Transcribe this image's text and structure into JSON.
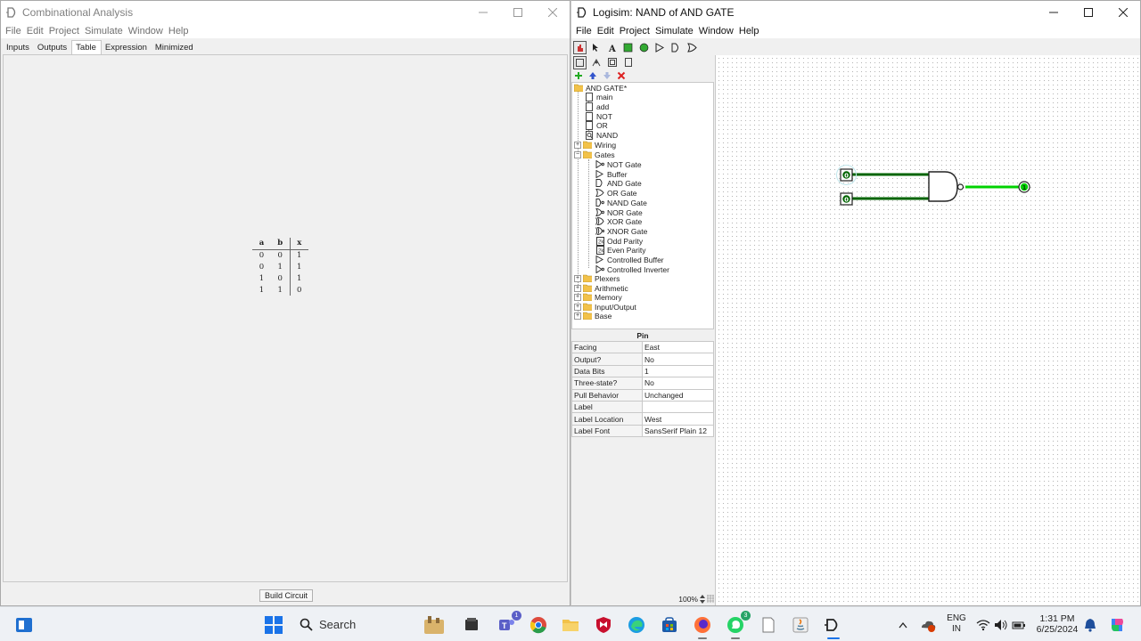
{
  "left_window": {
    "title": "Combinational Analysis",
    "menu": [
      "File",
      "Edit",
      "Project",
      "Simulate",
      "Window",
      "Help"
    ],
    "tabs": [
      "Inputs",
      "Outputs",
      "Table",
      "Expression",
      "Minimized"
    ],
    "active_tab": "Table",
    "truth_table": {
      "headers": [
        "a",
        "b",
        "x"
      ],
      "rows": [
        [
          "0",
          "0",
          "1"
        ],
        [
          "0",
          "1",
          "1"
        ],
        [
          "1",
          "0",
          "1"
        ],
        [
          "1",
          "1",
          "0"
        ]
      ]
    },
    "build_button": "Build Circuit"
  },
  "right_window": {
    "title": "Logisim: NAND of AND GATE",
    "menu": [
      "File",
      "Edit",
      "Project",
      "Simulate",
      "Window",
      "Help"
    ],
    "tree": {
      "project": "AND GATE*",
      "circuits": [
        "main",
        "add",
        "NOT",
        "OR",
        "NAND"
      ],
      "wiring": "Wiring",
      "gates_folder": "Gates",
      "gates": [
        "NOT Gate",
        "Buffer",
        "AND Gate",
        "OR Gate",
        "NAND Gate",
        "NOR Gate",
        "XOR Gate",
        "XNOR Gate",
        "Odd Parity",
        "Even Parity",
        "Controlled Buffer",
        "Controlled Inverter"
      ],
      "folders": [
        "Plexers",
        "Arithmetic",
        "Memory",
        "Input/Output",
        "Base"
      ]
    },
    "attributes": {
      "header": "Pin",
      "rows": [
        [
          "Facing",
          "East"
        ],
        [
          "Output?",
          "No"
        ],
        [
          "Data Bits",
          "1"
        ],
        [
          "Three-state?",
          "No"
        ],
        [
          "Pull Behavior",
          "Unchanged"
        ],
        [
          "Label",
          ""
        ],
        [
          "Label Location",
          "West"
        ],
        [
          "Label Font",
          "SansSerif Plain 12"
        ]
      ]
    },
    "zoom": "100%",
    "circuit": {
      "input_a_value": "0",
      "input_b_value": "0",
      "output_value": "1",
      "wire_on_color": "#00d200",
      "wire_off_color": "#006400"
    }
  },
  "taskbar": {
    "search_placeholder": "Search",
    "teams_badge": "1",
    "whatsapp_badge": "3",
    "language": "ENG",
    "region": "IN",
    "time": "1:31 PM",
    "date": "6/25/2024"
  }
}
